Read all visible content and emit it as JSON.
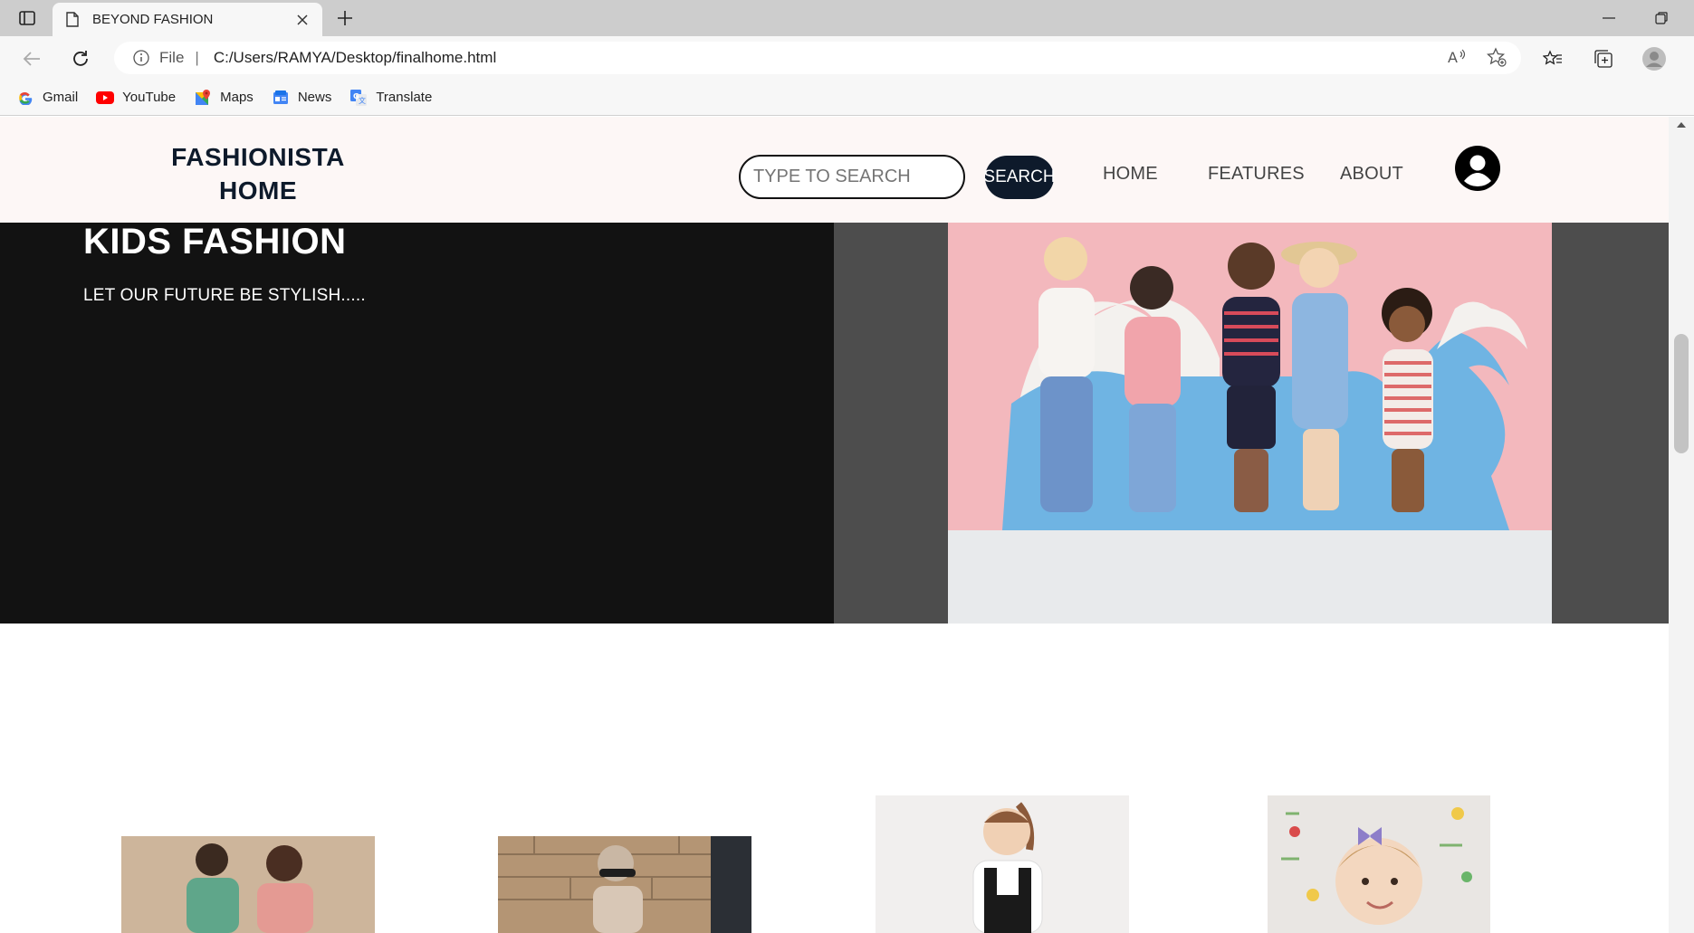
{
  "browser": {
    "tab_title": "BEYOND FASHION",
    "address_scheme": "File",
    "address_url": "C:/Users/RAMYA/Desktop/finalhome.html",
    "bookmarks": [
      {
        "label": "Gmail",
        "icon": "google-icon"
      },
      {
        "label": "YouTube",
        "icon": "youtube-icon"
      },
      {
        "label": "Maps",
        "icon": "maps-icon"
      },
      {
        "label": "News",
        "icon": "news-icon"
      },
      {
        "label": "Translate",
        "icon": "translate-icon"
      }
    ]
  },
  "site": {
    "brand_line1": "FASHIONISTA",
    "brand_line2": "HOME",
    "search_placeholder": "TYPE TO SEARCH",
    "search_button": "SEARCH",
    "nav": [
      "HOME",
      "FEATURES",
      "ABOUT"
    ]
  },
  "hero": {
    "title": "KIDS FASHION",
    "subtitle": "LET OUR FUTURE BE STYLISH....."
  },
  "colors": {
    "brand_navy": "#0e1a2b",
    "hero_dark": "#121212",
    "hero_gray": "#4d4d4d",
    "header_bg": "#fdf7f6"
  }
}
